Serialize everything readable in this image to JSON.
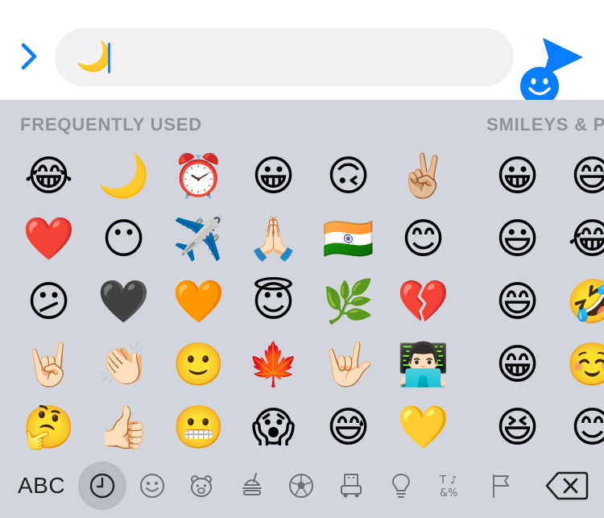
{
  "composer": {
    "text": "🌙",
    "accent_color": "#0a7cff"
  },
  "sections": {
    "frequent_title": "FREQUENTLY USED",
    "smileys_title": "SMILEYS & P"
  },
  "frequent_emojis": [
    "😂",
    "❤️",
    "😕",
    "🤘🏻",
    "🤔",
    "🌙",
    "😶",
    "🖤",
    "👏🏻",
    "👍🏻",
    "⏰",
    "✈️",
    "🧡",
    "🙂",
    "😬",
    "😀",
    "🙏🏻",
    "😇",
    "🍁",
    "😱",
    "🙃",
    "🇮🇳",
    "🌿",
    "🤟🏻",
    "😅",
    "✌🏼",
    "😊",
    "💔",
    "👨🏻‍💻",
    "💛"
  ],
  "smiley_emojis": [
    "😀",
    "😃",
    "😄",
    "😁",
    "😆",
    "😅",
    "😂",
    "🤣",
    "☺️",
    "😊"
  ],
  "category_bar": {
    "abc_label": "ABC",
    "active_category": "recent",
    "categories": [
      "recent",
      "smileys",
      "animals",
      "food",
      "activity",
      "travel",
      "objects",
      "symbols",
      "flags"
    ],
    "active_bg": "#b8bcc4"
  }
}
